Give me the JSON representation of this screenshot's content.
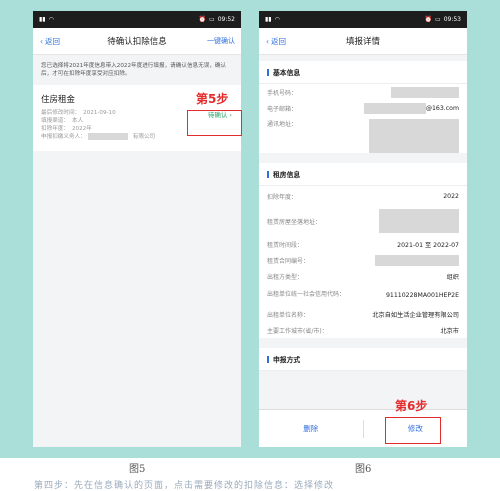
{
  "status": {
    "time": "09:52",
    "time2": "09:53"
  },
  "left_screen": {
    "back": "返回",
    "title": "待确认扣除信息",
    "confirm_all": "一键确认",
    "notice": "您已选择将2021年度信息带入2022年度进行填报，请确认信息无误，确认后，才可在扣除年度享受对应扣除。",
    "card": {
      "title": "住房租金",
      "lines": [
        {
          "label": "最后修改时间：",
          "value": "2021-09-10"
        },
        {
          "label": "填报渠道：",
          "value": "本人"
        },
        {
          "label": "扣除年度：",
          "value": "2022年"
        },
        {
          "label": "申报扣缴义务人：",
          "value": "有限公司"
        }
      ],
      "status": "待确认"
    },
    "step_label": "第5步"
  },
  "right_screen": {
    "back": "返回",
    "title": "填报详情",
    "basic_section": "基本信息",
    "basic_rows": [
      {
        "label": "手机号码："
      },
      {
        "label": "电子邮箱：",
        "value": "@163.com"
      },
      {
        "label": "通讯地址："
      }
    ],
    "rent_section": "租房信息",
    "rent_rows": [
      {
        "label": "扣除年度：",
        "value": "2022"
      },
      {
        "label": "租赁房屋坐落地址："
      },
      {
        "label": "租赁时间段：",
        "value": "2021-01 至 2022-07"
      },
      {
        "label": "租赁合同编号："
      },
      {
        "label": "出租方类型：",
        "value": "组织"
      },
      {
        "label": "出租单位统一社会信用代码：",
        "value": "91110228MA001HEP2E"
      },
      {
        "label": "出租单位名称：",
        "value": "北京自如生活企业管理有限公司"
      },
      {
        "label": "主要工作城市(省/市)：",
        "value": "北京市"
      }
    ],
    "declare_section": "申报方式",
    "delete_btn": "删除",
    "modify_btn": "修改",
    "step_label": "第6步"
  },
  "captions": {
    "fig5": "图5",
    "fig6": "图6"
  },
  "footer": "第四步：先在信息确认的页面，点击需要修改的扣除信息：选择修改"
}
